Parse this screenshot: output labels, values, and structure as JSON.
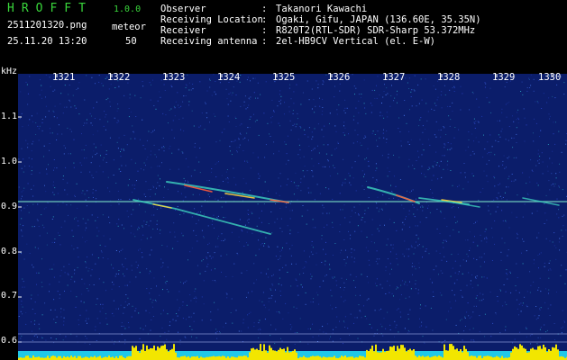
{
  "header": {
    "app_name": "HROFFT",
    "version": "1.0.0",
    "file_name": "2511201320.png",
    "meteor_label": "meteor",
    "date_time": "25.11.20 13:20",
    "meteor_count": "50",
    "info": [
      {
        "label": "Observer",
        "value": "Takanori Kawachi"
      },
      {
        "label": "Receiving Location",
        "value": "Ogaki, Gifu, JAPAN (136.60E, 35.35N)"
      },
      {
        "label": "Receiver",
        "value": "R820T2(RTL-SDR) SDR-Sharp 53.372MHz"
      },
      {
        "label": "Receiving antenna",
        "value": "2el-HB9CV Vertical (el. E-W)"
      }
    ]
  },
  "axes": {
    "y_unit": "kHz",
    "x_ticks": [
      "1321",
      "1322",
      "1323",
      "1324",
      "1325",
      "1326",
      "1327",
      "1328",
      "1329",
      "1330"
    ],
    "y_ticks": [
      "1.1",
      "1.0",
      "0.9",
      "0.8",
      "0.7",
      "0.6"
    ]
  },
  "colors": {
    "title_green": "#39d63b",
    "background_blue": "#0b1d6a",
    "carrier_line": "#7fe6c8",
    "baseline_cyan": "#20c8e8",
    "level_yellow": "#f2e600"
  }
}
